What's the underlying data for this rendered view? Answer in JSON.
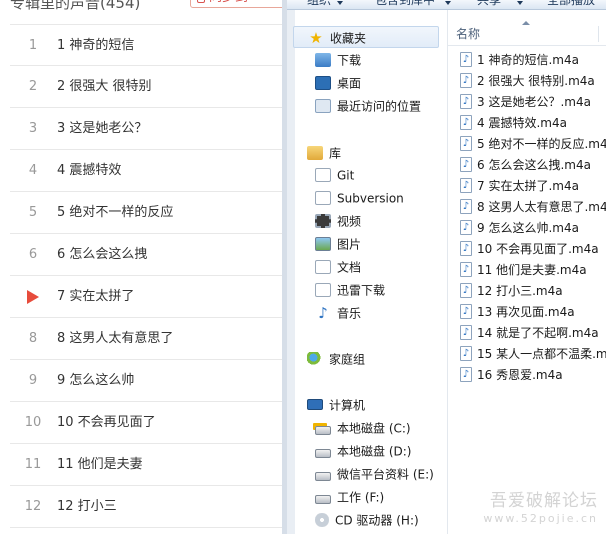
{
  "player": {
    "playlist_title": "专辑里的声音(454)",
    "sync_button": "同步到",
    "playing_index": 7,
    "tracks": [
      {
        "num": "1",
        "title": "1 神奇的短信"
      },
      {
        "num": "2",
        "title": "2 很强大 很特别"
      },
      {
        "num": "3",
        "title": "3 这是她老公？"
      },
      {
        "num": "4",
        "title": "4 震撼特效"
      },
      {
        "num": "5",
        "title": "5 绝对不一样的反应"
      },
      {
        "num": "6",
        "title": "6 怎么会这么拽"
      },
      {
        "num": "7",
        "title": "7 实在太拼了"
      },
      {
        "num": "8",
        "title": "8 这男人太有意思了"
      },
      {
        "num": "9",
        "title": "9 怎么这么帅"
      },
      {
        "num": "10",
        "title": "10 不会再见面了"
      },
      {
        "num": "11",
        "title": "11 他们是夫妻"
      },
      {
        "num": "12",
        "title": "12 打小三"
      }
    ]
  },
  "explorer": {
    "toolbar": {
      "organize": "组织",
      "include_in_library": "包含到库中",
      "share": "共享",
      "burn": "全部播放"
    },
    "nav": {
      "favorites": {
        "label": "收藏夹",
        "icon": "star-icon"
      },
      "favorites_items": [
        {
          "label": "下载",
          "icon": "downloads-folder-icon"
        },
        {
          "label": "桌面",
          "icon": "desktop-icon"
        },
        {
          "label": "最近访问的位置",
          "icon": "recent-places-icon"
        }
      ],
      "libraries": {
        "label": "库",
        "icon": "library-icon"
      },
      "library_items": [
        {
          "label": "Git",
          "icon": "document-icon"
        },
        {
          "label": "Subversion",
          "icon": "document-icon"
        },
        {
          "label": "视频",
          "icon": "video-icon"
        },
        {
          "label": "图片",
          "icon": "picture-icon"
        },
        {
          "label": "文档",
          "icon": "document-icon"
        },
        {
          "label": "迅雷下载",
          "icon": "document-icon"
        },
        {
          "label": "音乐",
          "icon": "music-icon"
        }
      ],
      "homegroup": {
        "label": "家庭组",
        "icon": "homegroup-icon"
      },
      "computer": {
        "label": "计算机",
        "icon": "computer-icon"
      },
      "computer_items": [
        {
          "label": "本地磁盘 (C:)",
          "icon": "system-drive-icon"
        },
        {
          "label": "本地磁盘 (D:)",
          "icon": "drive-icon"
        },
        {
          "label": "微信平台资料 (E:)",
          "icon": "drive-icon"
        },
        {
          "label": "工作 (F:)",
          "icon": "drive-icon"
        },
        {
          "label": "CD 驱动器 (H:)",
          "icon": "cd-drive-icon"
        }
      ]
    },
    "files_header": "名称",
    "files": [
      "1 神奇的短信.m4a",
      "2 很强大 很特别.m4a",
      "3 这是她老公？.m4a",
      "4 震撼特效.m4a",
      "5 绝对不一样的反应.m4a",
      "6 怎么会这么拽.m4a",
      "7 实在太拼了.m4a",
      "8 这男人太有意思了.m4a",
      "9 怎么这么帅.m4a",
      "10 不会再见面了.m4a",
      "11 他们是夫妻.m4a",
      "12 打小三.m4a",
      "13 再次见面.m4a",
      "14 就是了不起啊.m4a",
      "15 某人一点都不温柔.m4a",
      "16 秀恩爱.m4a"
    ],
    "watermark": "吾爱破解论坛",
    "watermark_sub": "www.52pojie.cn"
  }
}
